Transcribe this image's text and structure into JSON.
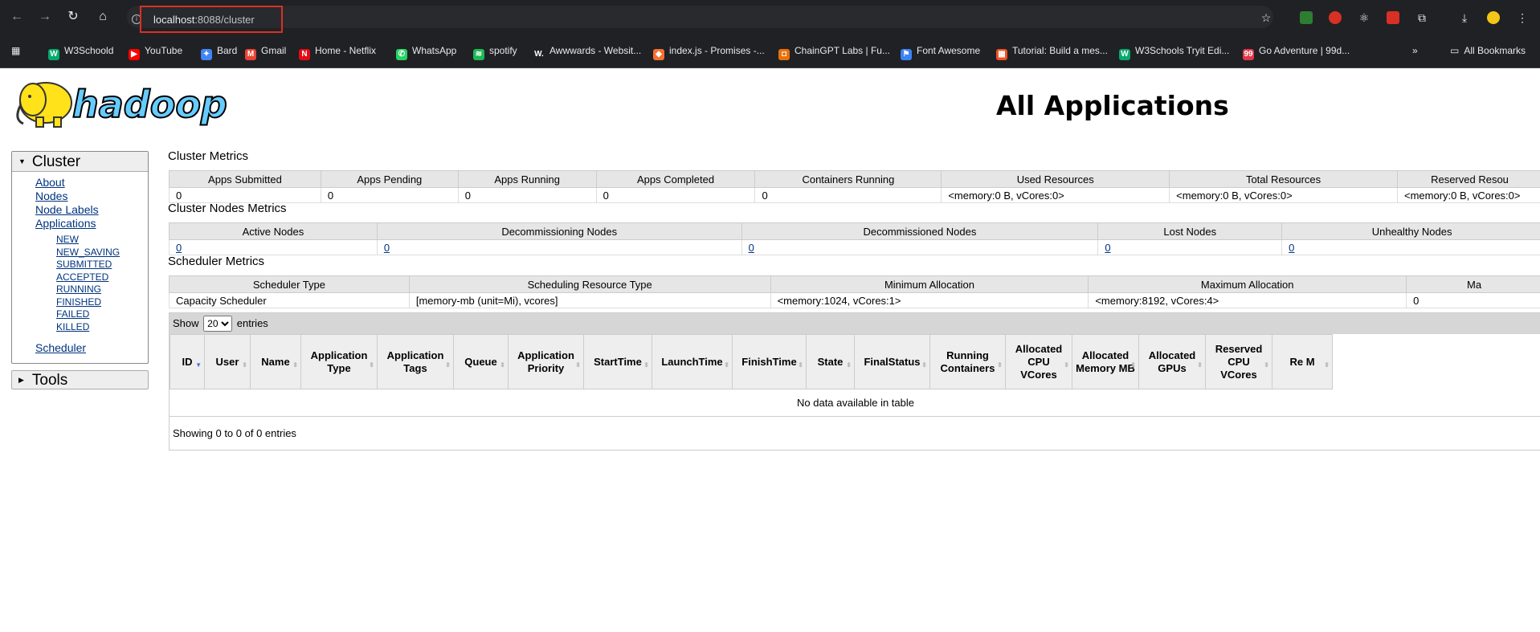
{
  "browser": {
    "url_host": "localhost",
    "url_rest": ":8088/cluster",
    "bookmarks": [
      {
        "label": "W3Schoold",
        "icon": "w3schools-icon",
        "color": "#04aa6d",
        "glyph": "W"
      },
      {
        "label": "YouTube",
        "icon": "youtube-icon",
        "color": "#ff0000",
        "glyph": "▶"
      },
      {
        "label": "Bard",
        "icon": "bard-icon",
        "color": "#4285f4",
        "glyph": "✦"
      },
      {
        "label": "Gmail",
        "icon": "gmail-icon",
        "color": "#ea4335",
        "glyph": "M"
      },
      {
        "label": "Home - Netflix",
        "icon": "netflix-icon",
        "color": "#e50914",
        "glyph": "N"
      },
      {
        "label": "WhatsApp",
        "icon": "whatsapp-icon",
        "color": "#25d366",
        "glyph": "✆"
      },
      {
        "label": "spotify",
        "icon": "spotify-icon",
        "color": "#1db954",
        "glyph": "≋"
      },
      {
        "label": "Awwwards - Websit...",
        "icon": "awwwards-icon",
        "color": "#202124",
        "glyph": "W."
      },
      {
        "label": "index.js - Promises -...",
        "icon": "codesandbox-icon",
        "color": "#f5702e",
        "glyph": "◆"
      },
      {
        "label": "ChainGPT Labs | Fu...",
        "icon": "chaingpt-icon",
        "color": "#e8710a",
        "glyph": "◘"
      },
      {
        "label": "Font Awesome",
        "icon": "font-awesome-icon",
        "color": "#3b82f6",
        "glyph": "⚑"
      },
      {
        "label": "Tutorial: Build a mes...",
        "icon": "microsoft-icon",
        "color": "#f25022",
        "glyph": "▦"
      },
      {
        "label": "W3Schools Tryit Edi...",
        "icon": "w3schools-icon",
        "color": "#04aa6d",
        "glyph": "W"
      },
      {
        "label": "Go Adventure | 99d...",
        "icon": "99designs-icon",
        "color": "#e2364a",
        "glyph": "99"
      }
    ],
    "all_bookmarks": "All Bookmarks"
  },
  "page": {
    "logo_text": "hadoop",
    "title": "All Applications"
  },
  "nav": {
    "cluster": "Cluster",
    "links": [
      "About",
      "Nodes",
      "Node Labels",
      "Applications"
    ],
    "states": [
      "NEW",
      "NEW_SAVING",
      "SUBMITTED",
      "ACCEPTED",
      "RUNNING",
      "FINISHED",
      "FAILED",
      "KILLED"
    ],
    "scheduler": "Scheduler",
    "tools": "Tools"
  },
  "cluster_metrics": {
    "title": "Cluster Metrics",
    "headers": [
      "Apps Submitted",
      "Apps Pending",
      "Apps Running",
      "Apps Completed",
      "Containers Running",
      "Used Resources",
      "Total Resources",
      "Reserved Resou"
    ],
    "values": [
      "0",
      "0",
      "0",
      "0",
      "0",
      "<memory:0 B, vCores:0>",
      "<memory:0 B, vCores:0>",
      "<memory:0 B, vCores:0>"
    ]
  },
  "node_metrics": {
    "title": "Cluster Nodes Metrics",
    "headers": [
      "Active Nodes",
      "Decommissioning Nodes",
      "Decommissioned Nodes",
      "Lost Nodes",
      "Unhealthy Nodes"
    ],
    "values": [
      "0",
      "0",
      "0",
      "0",
      "0"
    ]
  },
  "scheduler_metrics": {
    "title": "Scheduler Metrics",
    "headers": [
      "Scheduler Type",
      "Scheduling Resource Type",
      "Minimum Allocation",
      "Maximum Allocation",
      "Ma"
    ],
    "values": [
      "Capacity Scheduler",
      "[memory-mb (unit=Mi), vcores]",
      "<memory:1024, vCores:1>",
      "<memory:8192, vCores:4>",
      "0"
    ]
  },
  "apps": {
    "show_label": "Show",
    "page_size": "20",
    "entries_label": "entries",
    "columns": [
      "ID",
      "User",
      "Name",
      "Application Type",
      "Application Tags",
      "Queue",
      "Application Priority",
      "StartTime",
      "LaunchTime",
      "FinishTime",
      "State",
      "FinalStatus",
      "Running Containers",
      "Allocated CPU VCores",
      "Allocated Memory MB",
      "Allocated GPUs",
      "Reserved CPU VCores",
      "Re M"
    ],
    "empty_message": "No data available in table",
    "footer": "Showing 0 to 0 of 0 entries"
  }
}
